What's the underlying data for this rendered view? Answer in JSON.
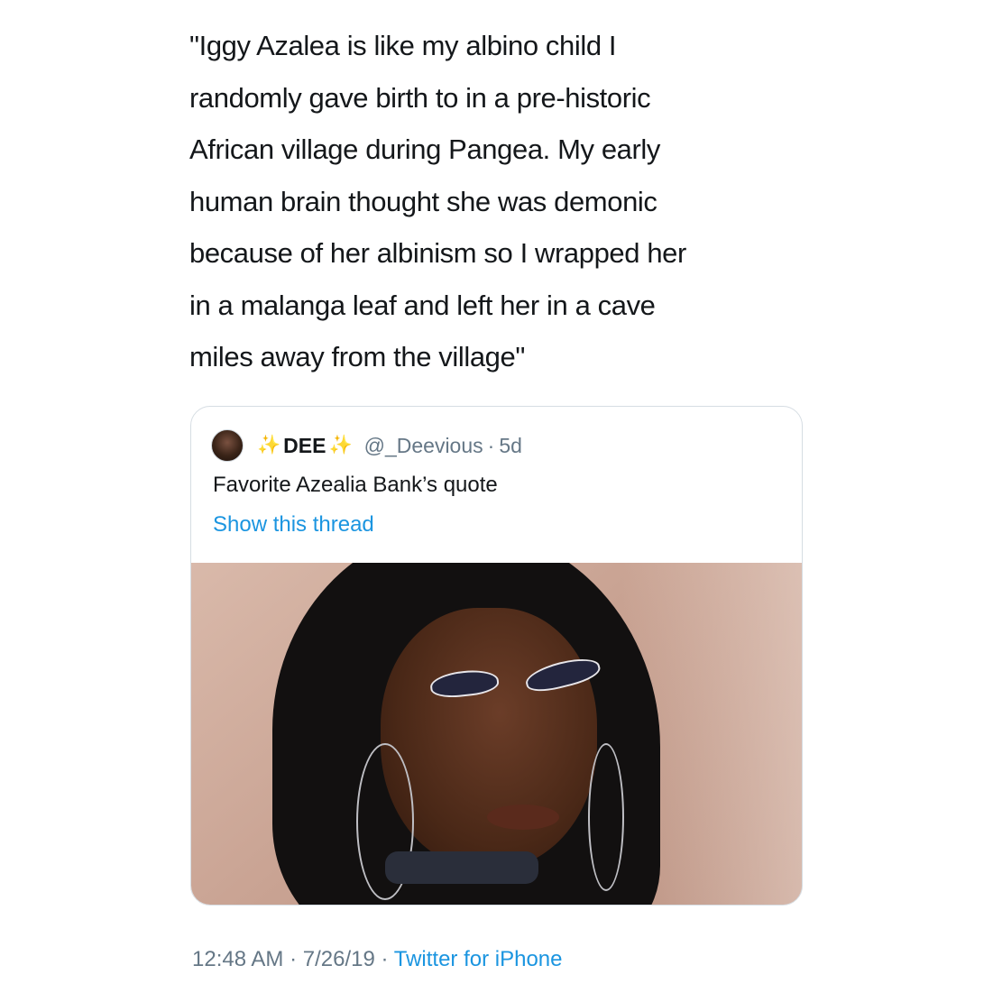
{
  "tweet": {
    "text_lines": [
      "\"Iggy Azalea is like my albino child I",
      "randomly gave birth to in a pre-historic",
      "African village during Pangea. My early",
      "human brain thought she was demonic",
      "because of her albinism so I wrapped her",
      "in a malanga leaf and left her in a cave",
      "miles away from the village\""
    ],
    "time": "12:48 AM",
    "date": "7/26/19",
    "separator": "·",
    "source": "Twitter for iPhone"
  },
  "quoted_tweet": {
    "sparkle_left": "✨",
    "display_name": "DEE",
    "sparkle_right": "✨",
    "handle": "@_Deevious",
    "separator": "·",
    "time_ago": "5d",
    "text": "Favorite Azealia Bank’s quote",
    "show_thread": "Show this thread",
    "avatar_icon": "avatar-icon",
    "photo_icon": "photo"
  },
  "colors": {
    "text": "#14171a",
    "muted": "#657786",
    "link": "#1b95e0",
    "border": "#d6dde3"
  }
}
